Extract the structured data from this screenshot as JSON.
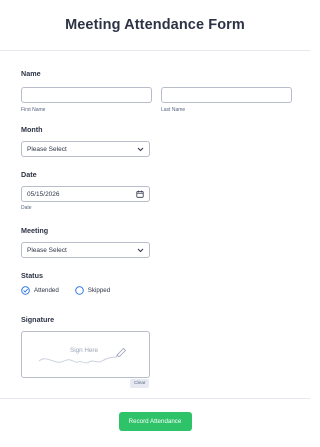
{
  "header": {
    "title": "Meeting Attendance Form"
  },
  "name": {
    "label": "Name",
    "first_sublabel": "First Name",
    "last_sublabel": "Last Name",
    "first_value": "",
    "last_value": ""
  },
  "month": {
    "label": "Month",
    "selected": "Please Select"
  },
  "date": {
    "label": "Date",
    "value": "05/15/2026",
    "sublabel": "Date"
  },
  "meeting": {
    "label": "Meeting",
    "selected": "Please Select"
  },
  "status": {
    "label": "Status",
    "options": [
      "Attended",
      "Skipped"
    ],
    "selected": "Attended"
  },
  "signature": {
    "label": "Signature",
    "placeholder": "Sign Here",
    "clear_label": "Clear"
  },
  "submit": {
    "label": "Record Attendance"
  },
  "colors": {
    "submit": "#2ec269",
    "accent": "#1f6fe0",
    "border": "#b8bdc9"
  },
  "icons": {
    "select": "chevron-down-icon",
    "date": "calendar-icon",
    "signature": "pen-icon"
  }
}
